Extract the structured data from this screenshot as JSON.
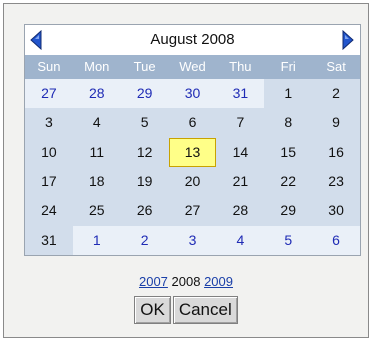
{
  "calendar": {
    "month_title": "August 2008",
    "nav": {
      "prev_icon": "triangle-left-icon",
      "next_icon": "triangle-right-icon",
      "arrow_color": "#2255cc"
    },
    "weekdays": [
      "Sun",
      "Mon",
      "Tue",
      "Wed",
      "Thu",
      "Fri",
      "Sat"
    ],
    "weeks": [
      [
        {
          "d": "27",
          "other": true
        },
        {
          "d": "28",
          "other": true
        },
        {
          "d": "29",
          "other": true
        },
        {
          "d": "30",
          "other": true
        },
        {
          "d": "31",
          "other": true
        },
        {
          "d": "1"
        },
        {
          "d": "2"
        }
      ],
      [
        {
          "d": "3"
        },
        {
          "d": "4"
        },
        {
          "d": "5"
        },
        {
          "d": "6"
        },
        {
          "d": "7"
        },
        {
          "d": "8"
        },
        {
          "d": "9"
        }
      ],
      [
        {
          "d": "10"
        },
        {
          "d": "11"
        },
        {
          "d": "12"
        },
        {
          "d": "13",
          "today": true
        },
        {
          "d": "14"
        },
        {
          "d": "15"
        },
        {
          "d": "16"
        }
      ],
      [
        {
          "d": "17"
        },
        {
          "d": "18"
        },
        {
          "d": "19"
        },
        {
          "d": "20"
        },
        {
          "d": "21"
        },
        {
          "d": "22"
        },
        {
          "d": "23"
        }
      ],
      [
        {
          "d": "24"
        },
        {
          "d": "25"
        },
        {
          "d": "26"
        },
        {
          "d": "27"
        },
        {
          "d": "28"
        },
        {
          "d": "29"
        },
        {
          "d": "30"
        }
      ],
      [
        {
          "d": "31"
        },
        {
          "d": "1",
          "other": true
        },
        {
          "d": "2",
          "other": true
        },
        {
          "d": "3",
          "other": true
        },
        {
          "d": "4",
          "other": true
        },
        {
          "d": "5",
          "other": true
        },
        {
          "d": "6",
          "other": true
        }
      ]
    ],
    "colors": {
      "weekday_bar": "#9fb4cd",
      "current_month_bg": "#d2ddeb",
      "other_month_bg": "#eaf0f8",
      "other_month_text": "#1f2bb5",
      "today_bg": "#ffff88"
    }
  },
  "years": {
    "prev": "2007",
    "current": "2008",
    "next": "2009"
  },
  "buttons": {
    "ok": "OK",
    "cancel": "Cancel"
  }
}
